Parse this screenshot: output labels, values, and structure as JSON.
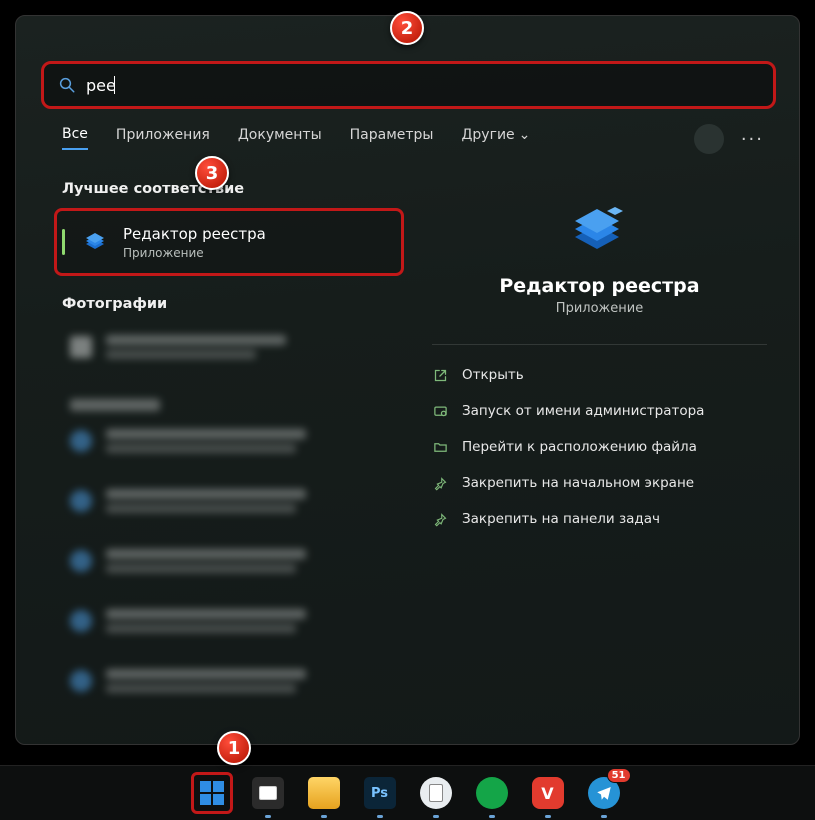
{
  "search": {
    "value": "рее"
  },
  "tabs": {
    "all": "Все",
    "apps": "Приложения",
    "docs": "Документы",
    "params": "Параметры",
    "more": "Другие"
  },
  "sections": {
    "best_match": "Лучшее соответствие",
    "photos": "Фотографии"
  },
  "best_match": {
    "title": "Редактор реестра",
    "subtitle": "Приложение"
  },
  "detail": {
    "title": "Редактор реестра",
    "subtitle": "Приложение",
    "actions": {
      "open": "Открыть",
      "admin": "Запуск от имени администратора",
      "location": "Перейти к расположению файла",
      "pin_start": "Закрепить на начальном экране",
      "pin_taskbar": "Закрепить на панели задач"
    }
  },
  "callouts": {
    "1": "1",
    "2": "2",
    "3": "3"
  },
  "taskbar": {
    "telegram_badge": "51"
  }
}
